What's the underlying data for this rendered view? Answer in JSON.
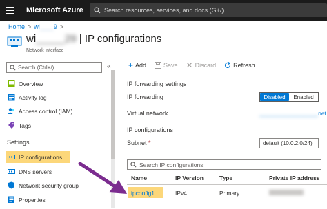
{
  "topbar": {
    "brand": "Microsoft Azure",
    "search_placeholder": "Search resources, services, and docs (G+/)"
  },
  "breadcrumb": {
    "home": "Home",
    "separator1": ">",
    "resource": "wi",
    "resource_tail": "9",
    "separator2": ">"
  },
  "header": {
    "title_prefix": "wi",
    "title_blurred": "_____29",
    "title_suffix": "| IP configurations",
    "subtitle": "Network interface"
  },
  "sidebar": {
    "search_placeholder": "Search (Ctrl+/)",
    "collapse": "«",
    "items": [
      {
        "label": "Overview",
        "icon": "overview-icon"
      },
      {
        "label": "Activity log",
        "icon": "activity-log-icon"
      },
      {
        "label": "Access control (IAM)",
        "icon": "access-control-icon"
      },
      {
        "label": "Tags",
        "icon": "tag-icon"
      }
    ],
    "section_settings": "Settings",
    "settings_items": [
      {
        "label": "IP configurations",
        "icon": "ip-config-icon"
      },
      {
        "label": "DNS servers",
        "icon": "dns-icon"
      },
      {
        "label": "Network security group",
        "icon": "nsg-icon"
      },
      {
        "label": "Properties",
        "icon": "properties-icon"
      }
    ]
  },
  "toolbar": {
    "add": "Add",
    "save": "Save",
    "discard": "Discard",
    "refresh": "Refresh"
  },
  "main": {
    "ip_forwarding_settings": "IP forwarding settings",
    "ip_forwarding_label": "IP forwarding",
    "toggle_disabled": "Disabled",
    "toggle_enabled": "Enabled",
    "virtual_network_label": "Virtual network",
    "virtual_network_value_tail": "net",
    "ip_configurations_heading": "IP configurations",
    "subnet_label": "Subnet",
    "subnet_required": "*",
    "subnet_value": "default (10.0.2.0/24)",
    "search_placeholder": "Search IP configurations",
    "columns": [
      "Name",
      "IP Version",
      "Type",
      "Private IP address"
    ],
    "rows": [
      {
        "name": "ipconfig1",
        "ip_version": "IPv4",
        "type": "Primary"
      }
    ]
  },
  "colors": {
    "azure_blue": "#0078d4",
    "highlight": "#fcd77a",
    "arrow": "#7b2c8f",
    "topbar": "#1b1b1b"
  }
}
